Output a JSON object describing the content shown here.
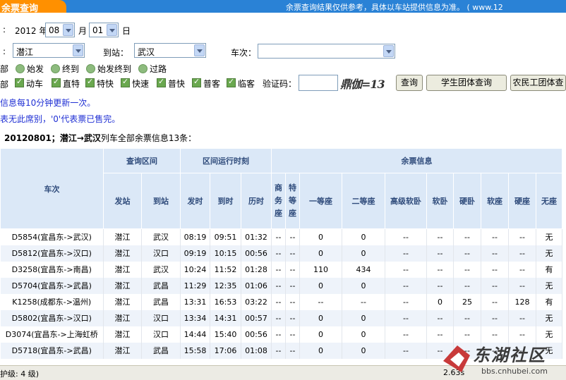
{
  "header": {
    "title": "余票查询",
    "notice": "余票查询结果仅供参考，具体以车站提供信息为准。 ( www.12"
  },
  "form": {
    "date_prefix": ":",
    "year_label": "2012 年",
    "month_value": "08",
    "month_label": "月",
    "day_value": "01",
    "day_label": "日",
    "from_prefix": ":",
    "from_value": "潜江",
    "to_label": "到站：",
    "to_value": "武汉",
    "train_label": "车次：",
    "train_value": "",
    "station_group_label": "部",
    "radios": [
      "始发",
      "终到",
      "始发终到",
      "过路"
    ],
    "type_group_label": "部",
    "checkboxes": [
      "动车",
      "直特",
      "特快",
      "快速",
      "普快",
      "普客",
      "临客"
    ],
    "captcha_label": "验证码：",
    "captcha_text": "鼎伽=13",
    "query_button": "查询",
    "student_button": "学生团体查询",
    "migrant_button": "农民工团体查"
  },
  "info": {
    "line1": "信息每10分钟更新一次。",
    "line2": "表无此席别，'0'代表票已售完。"
  },
  "summary": {
    "date": "20120801；",
    "route": "潜江→武汉",
    "suffix": "列车全部余票信息13条："
  },
  "table": {
    "header_train": "车次",
    "header_section": "查询区间",
    "header_time": "区间运行时刻",
    "header_tickets": "余票信息",
    "sub_from": "发站",
    "sub_to": "到站",
    "sub_depart": "发时",
    "sub_arrive": "到时",
    "sub_duration": "历时",
    "sub_business": "商务座",
    "sub_special": "特等座",
    "sub_first": "一等座",
    "sub_second": "二等座",
    "sub_hsoft": "高级软卧",
    "sub_soft_sleeper": "软卧",
    "sub_hard_sleeper": "硬卧",
    "sub_soft_seat": "软座",
    "sub_hard_seat": "硬座",
    "sub_no_seat": "无座",
    "rows": [
      [
        "D5854(宜昌东->武汉)",
        "潜江",
        "武汉",
        "08:19",
        "09:51",
        "01:32",
        "--",
        "--",
        "0",
        "0",
        "--",
        "--",
        "--",
        "--",
        "--",
        "无"
      ],
      [
        "D5812(宜昌东->汉口)",
        "潜江",
        "汉口",
        "09:19",
        "10:15",
        "00:56",
        "--",
        "--",
        "0",
        "0",
        "--",
        "--",
        "--",
        "--",
        "--",
        "无"
      ],
      [
        "D3258(宜昌东->南昌)",
        "潜江",
        "武汉",
        "10:24",
        "11:52",
        "01:28",
        "--",
        "--",
        "110",
        "434",
        "--",
        "--",
        "--",
        "--",
        "--",
        "有"
      ],
      [
        "D5704(宜昌东->武昌)",
        "潜江",
        "武昌",
        "11:29",
        "12:35",
        "01:06",
        "--",
        "--",
        "0",
        "0",
        "--",
        "--",
        "--",
        "--",
        "--",
        "无"
      ],
      [
        "K1258(成都东->温州)",
        "潜江",
        "武昌",
        "13:31",
        "16:53",
        "03:22",
        "--",
        "--",
        "--",
        "--",
        "--",
        "0",
        "25",
        "--",
        "128",
        "有"
      ],
      [
        "D5802(宜昌东->汉口)",
        "潜江",
        "汉口",
        "13:34",
        "14:31",
        "00:57",
        "--",
        "--",
        "0",
        "0",
        "--",
        "--",
        "--",
        "--",
        "--",
        "无"
      ],
      [
        "D3074(宜昌东->上海虹桥",
        "潜江",
        "汉口",
        "14:44",
        "15:40",
        "00:56",
        "--",
        "--",
        "0",
        "0",
        "--",
        "--",
        "--",
        "--",
        "--",
        "无"
      ],
      [
        "D5718(宜昌东->武昌)",
        "潜江",
        "武昌",
        "15:58",
        "17:06",
        "01:08",
        "--",
        "--",
        "0",
        "0",
        "--",
        "--",
        "--",
        "--",
        "--",
        "无"
      ]
    ]
  },
  "status": {
    "zone": "护级: 4 级)",
    "speed": "2.63s"
  },
  "watermark": {
    "name": "东湖社区",
    "url": "bbs.cnhubei.com"
  }
}
